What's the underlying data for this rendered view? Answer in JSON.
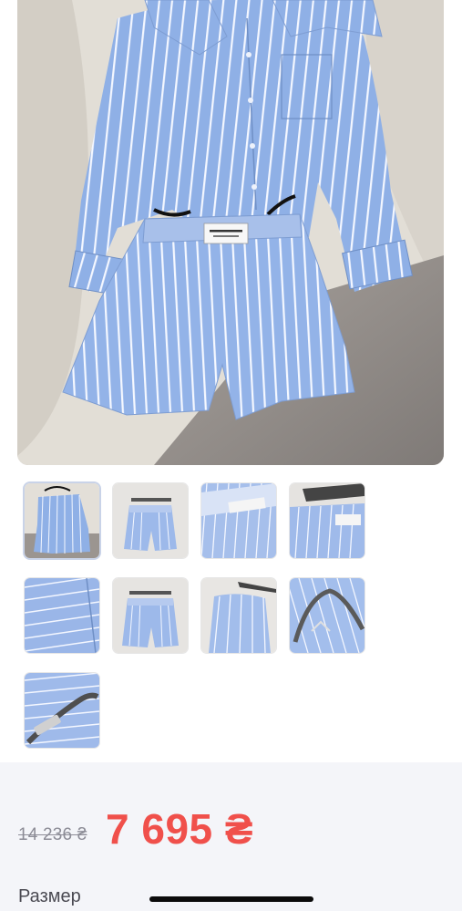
{
  "product": {
    "main_image_alt": "Blue striped shirt and shorts set",
    "thumbnails": [
      {
        "name": "thumb-1",
        "selected": true
      },
      {
        "name": "thumb-2",
        "selected": false
      },
      {
        "name": "thumb-3",
        "selected": false
      },
      {
        "name": "thumb-4",
        "selected": false
      },
      {
        "name": "thumb-5",
        "selected": false
      },
      {
        "name": "thumb-6",
        "selected": false
      },
      {
        "name": "thumb-7",
        "selected": false
      },
      {
        "name": "thumb-8",
        "selected": false
      },
      {
        "name": "thumb-9",
        "selected": false
      }
    ]
  },
  "price": {
    "old": "14 236 ₴",
    "current": "7 695 ₴"
  },
  "size": {
    "label": "Размер"
  },
  "colors": {
    "price_current": "#f0504b",
    "price_old": "#8c8c96",
    "panel_bg": "#f4f5f9",
    "fabric": "#8fb0e6"
  }
}
